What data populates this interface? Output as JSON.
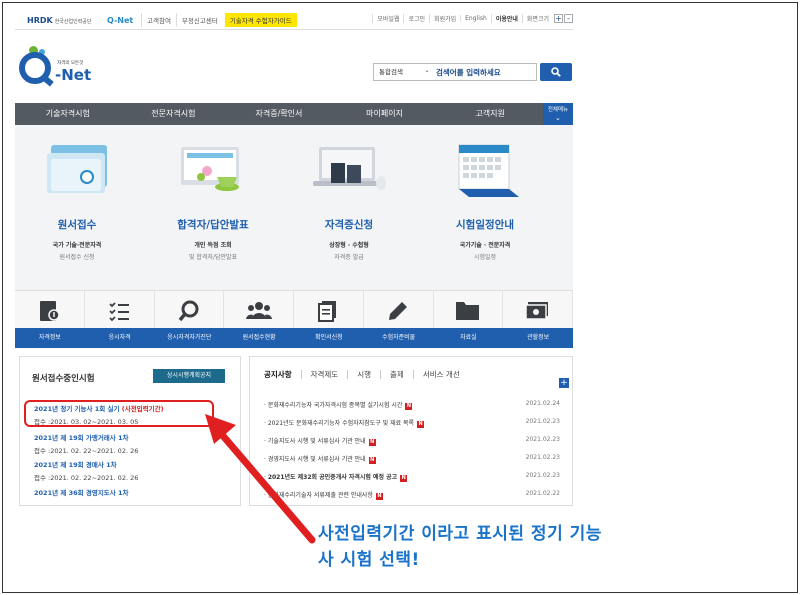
{
  "util": {
    "hrdk": "HRDK",
    "hrdk_sub": "한국산업인력공단",
    "qnet_small": "Q-Net",
    "links": [
      "고객참여",
      "부정신고센터",
      "기술자격 수험자가이드"
    ],
    "right_links": [
      "모바일웹",
      "로그인",
      "회원가입",
      "English",
      "이용안내",
      "화면크기"
    ],
    "zoom_in": "+",
    "zoom_out": "-"
  },
  "logo": {
    "tagline": "자격의 모든것",
    "name": "-Net"
  },
  "search": {
    "scope": "통합검색",
    "placeholder": "검색어를 입력하세요"
  },
  "gnb": {
    "items": [
      "기술자격시험",
      "전문자격시험",
      "자격증/확인서",
      "마이페이지",
      "고객지원"
    ],
    "all_label": "전체메뉴"
  },
  "visual": [
    {
      "title": "원서접수",
      "sub1": "국가 기술·전문자격",
      "sub2": "원서접수 신청"
    },
    {
      "title": "합격자/답안발표",
      "sub1": "개인 득점 조회",
      "sub2": "및 합격자/답안발표"
    },
    {
      "title": "자격증신청",
      "sub1": "상장형 · 수첩형",
      "sub2": "자격증 발급"
    },
    {
      "title": "시험일정안내",
      "sub1": "국가기술 · 전문자격",
      "sub2": "시험일정"
    }
  ],
  "quick": [
    "자격정보",
    "응시자격",
    "응시자격자가진단",
    "원서접수현황",
    "확인서신청",
    "수험자준비물",
    "자료실",
    "관할정보"
  ],
  "exams": {
    "heading": "원서접수중인시험",
    "button": "상시시행계획공지",
    "items": [
      {
        "name": "2021년 정기 기능사 1회 실기",
        "tag": "(사전입력기간)",
        "period": "접수 :2021. 03. 02~2021. 03. 05"
      },
      {
        "name": "2021년 제 19회 가맹거래사 1차",
        "tag": "",
        "period": "접수 :2021. 02. 22~2021. 02. 26"
      },
      {
        "name": "2021년 제 19회 경매사 1차",
        "tag": "",
        "period": "접수 :2021. 02. 22~2021. 02. 26"
      },
      {
        "name": "2021년 제 36회 경영지도사 1차",
        "tag": "",
        "period": ""
      }
    ]
  },
  "notices": {
    "tabs": [
      "공지사항",
      "자격제도",
      "시행",
      "출제",
      "서비스 개선"
    ],
    "more": "+",
    "badge": "N",
    "items": [
      {
        "title": "문화재수리기능자 국가자격시험 종목별 실기시험 시간",
        "date": "2021.02.24",
        "bold": false
      },
      {
        "title": "2021년도 문화재수리기능자 수험자지참도구 및 재료 목록",
        "date": "2021.02.23",
        "bold": false
      },
      {
        "title": "기술지도사 시행 및 서류심사 기관 안내",
        "date": "2021.02.23",
        "bold": false
      },
      {
        "title": "경영지도사 시행 및 서류심사 기관 안내",
        "date": "2021.02.23",
        "bold": false
      },
      {
        "title": "2021년도 제32회 공인중개사 자격시험 예정 공고",
        "date": "2021.02.23",
        "bold": true
      },
      {
        "title": "문화재수리기술자 서류제출 관련 안내사항",
        "date": "2021.02.22",
        "bold": false
      }
    ]
  },
  "annotation": {
    "line1": "사전입력기간 이라고 표시된 정기 기능",
    "line2": "사 시험 선택!",
    "color": "#e02020"
  }
}
